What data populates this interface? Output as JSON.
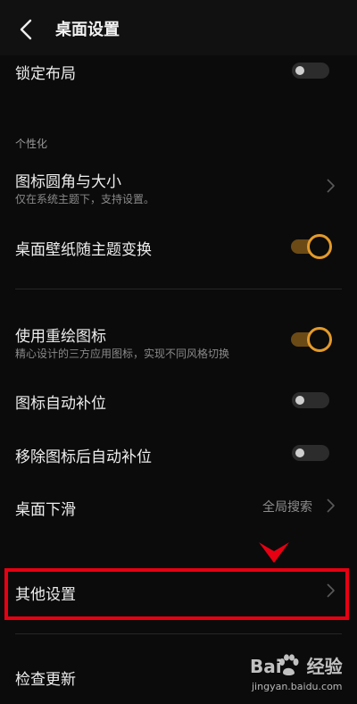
{
  "header": {
    "back_icon": "chevron-left-icon",
    "title": "桌面设置"
  },
  "settings": {
    "lock_layout": {
      "title": "锁定布局",
      "enabled": false
    },
    "section_personal": "个性化",
    "icon_corner_size": {
      "title": "图标圆角与大小",
      "subtitle": "仅在系统主题下，支持设置。"
    },
    "wallpaper_follow_theme": {
      "title": "桌面壁纸随主题变换",
      "enabled": true
    },
    "redraw_icons": {
      "title": "使用重绘图标",
      "subtitle": "精心设计的三方应用图标，实现不同风格切换",
      "enabled": true
    },
    "auto_fill": {
      "title": "图标自动补位",
      "enabled": false
    },
    "auto_fill_after_remove": {
      "title": "移除图标后自动补位",
      "enabled": false
    },
    "swipe_down": {
      "title": "桌面下滑",
      "value": "全局搜索"
    },
    "other_settings": {
      "title": "其他设置"
    },
    "check_update": {
      "title": "检查更新"
    }
  },
  "watermark": {
    "brand_left": "Bai",
    "brand_right": "经验",
    "url": "jingyan.baidu.com"
  },
  "colors": {
    "background": "#0b0b0b",
    "accent": "#e39a2a",
    "highlight": "#e60012"
  }
}
